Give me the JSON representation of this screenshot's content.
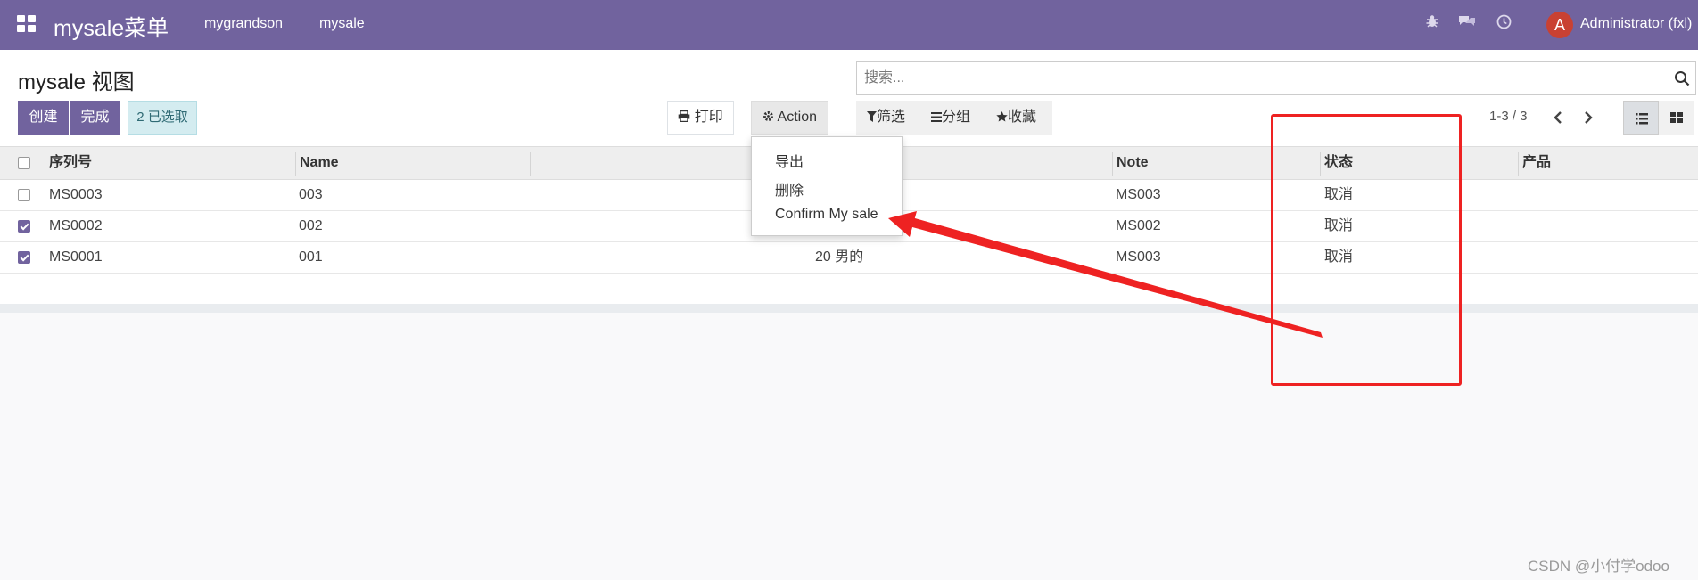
{
  "navbar": {
    "brand": "mysale菜单",
    "menu": [
      "mygrandson",
      "mysale"
    ],
    "avatar_letter": "A",
    "user": "Administrator (fxl)",
    "color": "#71639e"
  },
  "control_panel": {
    "title": "mysale 视图",
    "create_label": "创建",
    "done_label": "完成",
    "selected_label": "2 已选取",
    "print_label": "打印",
    "action_label": "Action",
    "search_placeholder": "搜索...",
    "filters_label": "筛选",
    "groupby_label": "分组",
    "favorites_label": "收藏",
    "pager": "1-3 / 3"
  },
  "action_menu": {
    "items": [
      "导出",
      "删除",
      "Confirm My sale"
    ]
  },
  "table": {
    "columns": [
      "序列号",
      "Name",
      "Note",
      "状态",
      "产品"
    ],
    "rows": [
      {
        "checked": false,
        "serial": "MS0003",
        "name": "003",
        "mid": "",
        "note": "MS003",
        "state": "取消"
      },
      {
        "checked": true,
        "serial": "MS0002",
        "name": "002",
        "mid": "",
        "note": "MS002",
        "state": "取消"
      },
      {
        "checked": true,
        "serial": "MS0001",
        "name": "001",
        "mid": "20  男的",
        "note": "MS003",
        "state": "取消"
      }
    ]
  },
  "watermark": "CSDN @小付学odoo",
  "annotation_color": "#ee2222"
}
